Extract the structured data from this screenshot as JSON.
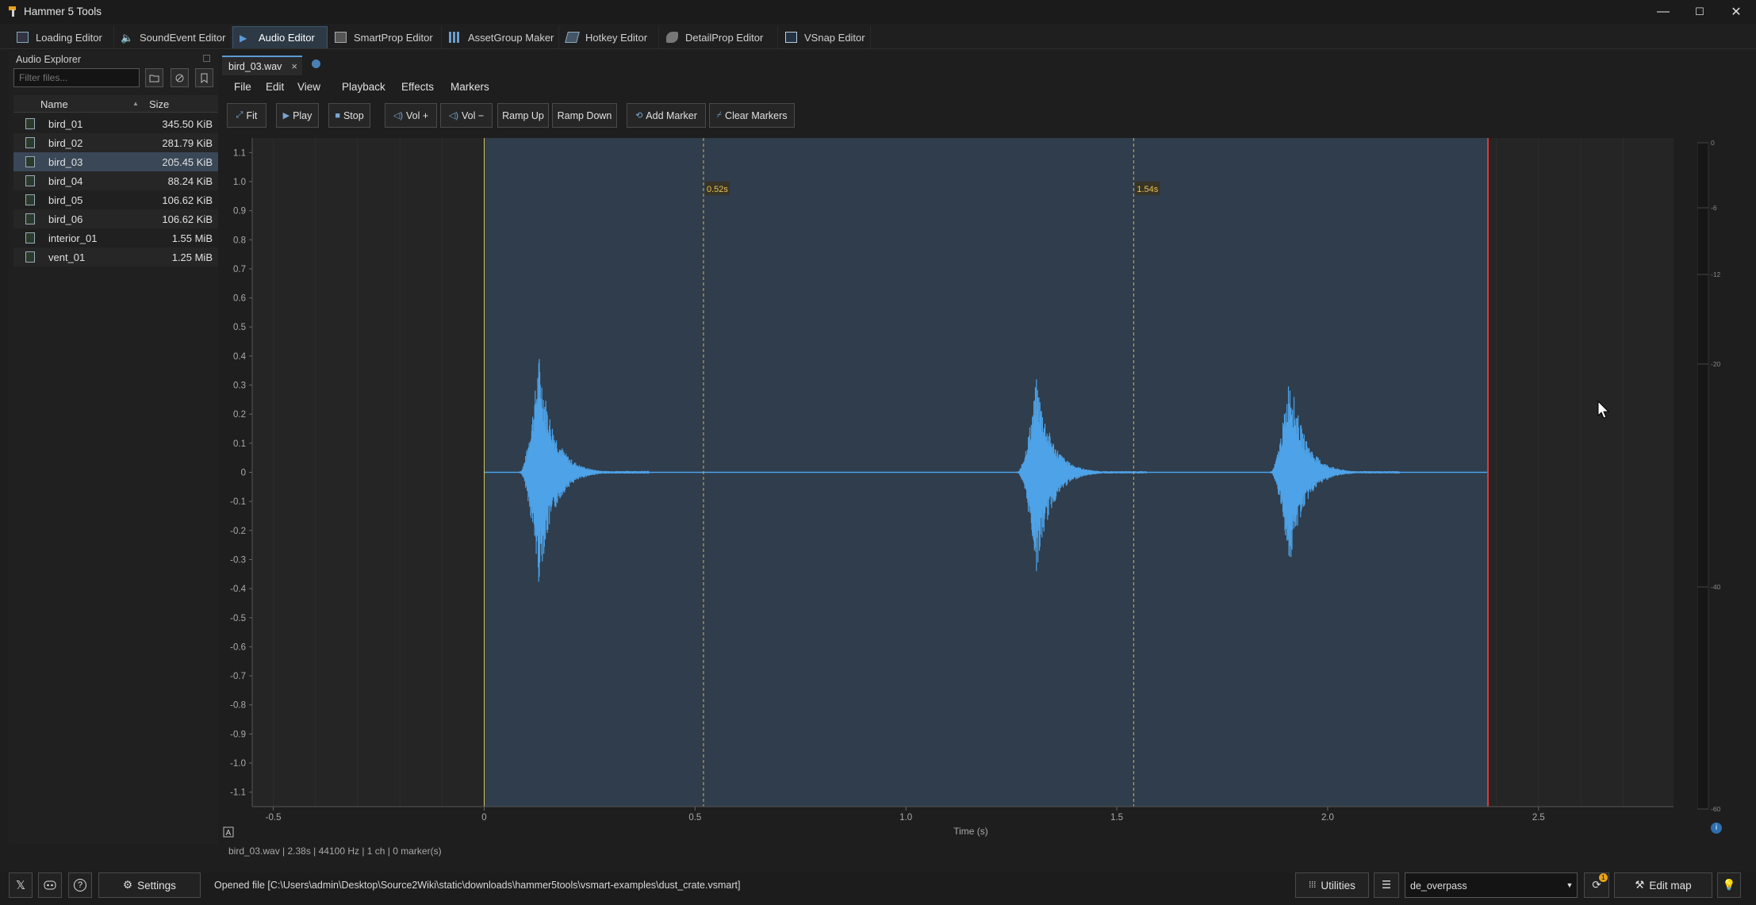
{
  "window": {
    "title": "Hammer 5 Tools",
    "minimize": "—",
    "maximize": "☐",
    "close": "✕"
  },
  "tabs": [
    {
      "label": "Loading Editor",
      "icon": "image-icon"
    },
    {
      "label": "SoundEvent Editor",
      "icon": "speaker-icon"
    },
    {
      "label": "Audio Editor",
      "icon": "play-icon",
      "active": true
    },
    {
      "label": "SmartProp Editor",
      "icon": "cube-icon"
    },
    {
      "label": "AssetGroup Maker",
      "icon": "grid-icon"
    },
    {
      "label": "Hotkey Editor",
      "icon": "keyboard-icon"
    },
    {
      "label": "DetailProp Editor",
      "icon": "leaf-icon"
    },
    {
      "label": "VSnap Editor",
      "icon": "snap-icon"
    }
  ],
  "explorer": {
    "title": "Audio Explorer",
    "filter_placeholder": "Filter files...",
    "col_name": "Name",
    "col_size": "Size",
    "files": [
      {
        "name": "bird_01",
        "size": "345.50 KiB"
      },
      {
        "name": "bird_02",
        "size": "281.79 KiB"
      },
      {
        "name": "bird_03",
        "size": "205.45 KiB",
        "selected": true
      },
      {
        "name": "bird_04",
        "size": "88.24 KiB"
      },
      {
        "name": "bird_05",
        "size": "106.62 KiB"
      },
      {
        "name": "bird_06",
        "size": "106.62 KiB"
      },
      {
        "name": "interior_01",
        "size": "1.55 MiB"
      },
      {
        "name": "vent_01",
        "size": "1.25 MiB"
      }
    ]
  },
  "document": {
    "tab_label": "bird_03.wav",
    "close": "×"
  },
  "menu": [
    "File",
    "Edit",
    "View",
    "Playback",
    "Effects",
    "Markers"
  ],
  "toolbar": {
    "fit": "Fit",
    "play": "Play",
    "stop": "Stop",
    "vol_up": "Vol +",
    "vol_down": "Vol −",
    "ramp_up": "Ramp Up",
    "ramp_down": "Ramp Down",
    "add_marker": "Add Marker",
    "clear_markers": "Clear Markers"
  },
  "chart_data": {
    "type": "line",
    "xlabel": "Time (s)",
    "ylabel": "",
    "xlim": [
      -0.55,
      2.82
    ],
    "ylim": [
      -1.15,
      1.15
    ],
    "x_ticks": [
      -0.5,
      0,
      0.5,
      1.0,
      1.5,
      2.0,
      2.5
    ],
    "x_tick_labels": [
      "-0.5",
      "0",
      "0.5",
      "1.0",
      "1.5",
      "2.0",
      "2.5"
    ],
    "y_ticks": [
      1.1,
      1.0,
      0.9,
      0.8,
      0.7,
      0.6,
      0.5,
      0.4,
      0.3,
      0.2,
      0.1,
      0,
      -0.1,
      -0.2,
      -0.3,
      -0.4,
      -0.5,
      -0.6,
      -0.7,
      -0.8,
      -0.9,
      -1.0,
      -1.1
    ],
    "y_tick_labels": [
      "1.1",
      "1.0",
      "0.9",
      "0.8",
      "0.7",
      "0.6",
      "0.5",
      "0.4",
      "0.3",
      "0.2",
      "0.1",
      "0",
      "-0.1",
      "-0.2",
      "-0.3",
      "-0.4",
      "-0.5",
      "-0.6",
      "-0.7",
      "-0.8",
      "-0.9",
      "-1.0",
      "-1.1"
    ],
    "duration": 2.38,
    "markers": [
      {
        "t": 0.52,
        "label": "0.52s"
      },
      {
        "t": 1.54,
        "label": "1.54s"
      }
    ],
    "playhead": 2.38,
    "bursts": [
      {
        "t": 0.13,
        "pos": 0.41,
        "neg": -0.39
      },
      {
        "t": 1.31,
        "pos": 0.33,
        "neg": -0.35
      },
      {
        "t": 1.91,
        "pos": 0.35,
        "neg": -0.33
      }
    ],
    "waveform_color": "#4ea3e8",
    "selection_color": "#2f3d4c",
    "playhead_color": "#e03a3a",
    "marker_color": "#d8b34a"
  },
  "meter": {
    "labels": [
      "0",
      "-6",
      "-12",
      "-20",
      "-40",
      "-60"
    ]
  },
  "info": "bird_03.wav  |  2.38s  |  44100 Hz  |  1 ch  |  0 marker(s)",
  "bottom": {
    "settings": "Settings",
    "status": "Opened file [C:\\Users\\admin\\Desktop\\Source2Wiki\\static\\downloads\\hammer5tools\\vsmart-examples\\dust_crate.vsmart]",
    "utilities": "Utilities",
    "map": "de_overpass",
    "edit_map": "Edit map"
  }
}
